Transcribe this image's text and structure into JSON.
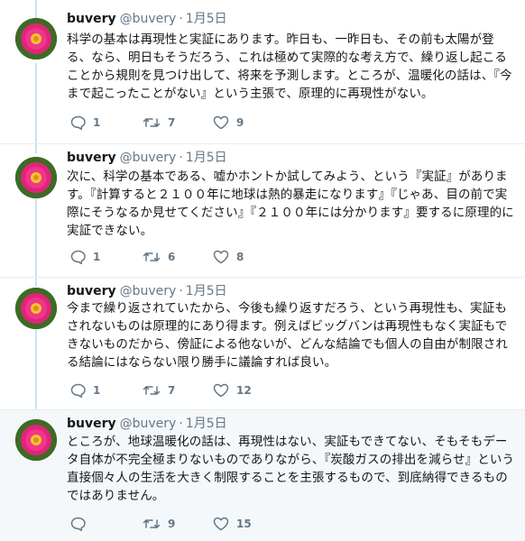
{
  "colors": {
    "thread_line": "#c4e5f7",
    "name_text": "#14171a",
    "secondary_text": "#657786",
    "last_tweet_bg": "#f5f8fa"
  },
  "tweets": [
    {
      "name": "buvery",
      "handle": "@buvery",
      "separator": "·",
      "date": "1月5日",
      "text": "科学の基本は再現性と実証にあります。昨日も、一昨日も、その前も太陽が登る、なら、明日もそうだろう、これは極めて実際的な考え方で、繰り返し起こることから規則を見つけ出して、将来を予測します。ところが、温暖化の話は、『今まで起こったことがない』という主張で、原理的に再現性がない。",
      "replies": "1",
      "retweets": "7",
      "likes": "9"
    },
    {
      "name": "buvery",
      "handle": "@buvery",
      "separator": "·",
      "date": "1月5日",
      "text": "次に、科学の基本である、嘘かホントか試してみよう、という『実証』があります。『計算すると２１００年に地球は熱的暴走になります』『じゃあ、目の前で実際にそうなるか見せてください』『２１００年には分かります』要するに原理的に実証できない。",
      "replies": "1",
      "retweets": "6",
      "likes": "8"
    },
    {
      "name": "buvery",
      "handle": "@buvery",
      "separator": "·",
      "date": "1月5日",
      "text": "今まで繰り返されていたから、今後も繰り返すだろう、という再現性も、実証もされないものは原理的にあり得ます。例えばビッグバンは再現性もなく実証もできないものだから、傍証による他ないが、どんな結論でも個人の自由が制限される結論にはならない限り勝手に議論すれば良い。",
      "replies": "1",
      "retweets": "7",
      "likes": "12"
    },
    {
      "name": "buvery",
      "handle": "@buvery",
      "separator": "·",
      "date": "1月5日",
      "text": "ところが、地球温暖化の話は、再現性はない、実証もできてない、そもそもデータ自体が不完全極まりないものでありながら、『炭酸ガスの排出を減らせ』という直接個々人の生活を大きく制限することを主張するもので、到底納得できるものではありません。",
      "replies": "",
      "retweets": "9",
      "likes": "15"
    }
  ]
}
